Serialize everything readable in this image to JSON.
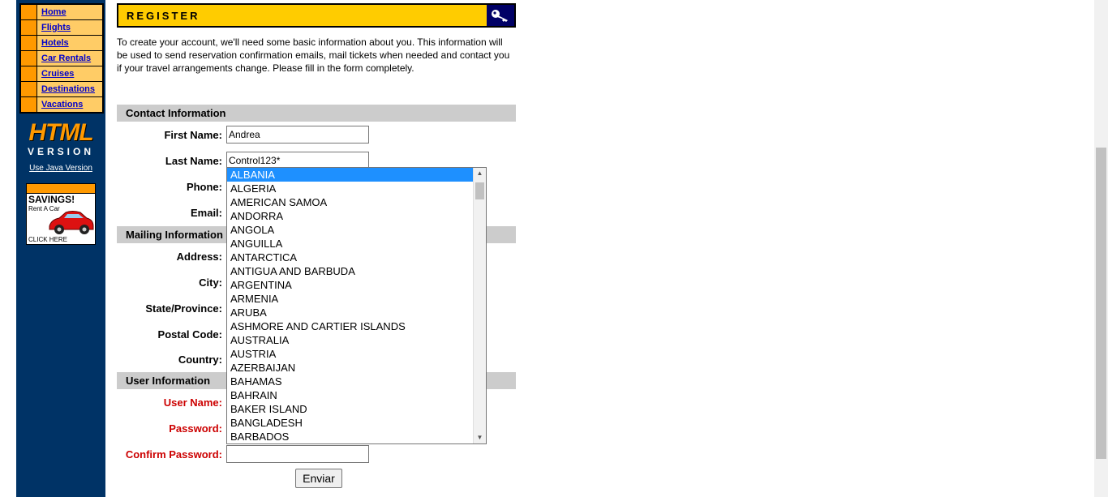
{
  "nav": {
    "items": [
      "Home",
      "Flights",
      "Hotels",
      "Car Rentals",
      "Cruises",
      "Destinations",
      "Vacations"
    ]
  },
  "logo": {
    "line1": "HTML",
    "line2": "VERSION"
  },
  "java_link": "Use Java Version",
  "ad": {
    "title": "SAVINGS!",
    "subtitle": "Rent A Car",
    "cta": "CLICK HERE"
  },
  "header": {
    "title": "REGISTER",
    "icon": "key-icon"
  },
  "intro": "To create your account, we'll need some basic information about you. This information will be used to send reservation confirmation emails, mail tickets when needed and contact you if your travel arrangements change. Please fill in the form completely.",
  "contact": {
    "heading": "Contact Information",
    "first_name_label": "First Name:",
    "first_name_value": "Andrea",
    "last_name_label": "Last Name:",
    "last_name_value": "Control123*",
    "phone_label": "Phone:",
    "email_label": "Email:"
  },
  "mailing": {
    "heading": "Mailing Information",
    "address_label": "Address:",
    "city_label": "City:",
    "state_label": "State/Province:",
    "postal_label": "Postal Code:",
    "country_label": "Country:"
  },
  "user": {
    "heading": "User Information",
    "username_label": "User Name:",
    "password_label": "Password:",
    "confirm_label": "Confirm Password:"
  },
  "submit_label": "Enviar",
  "country_dropdown": {
    "selected": "ALBANIA",
    "options": [
      "ALBANIA",
      "ALGERIA",
      "AMERICAN SAMOA",
      "ANDORRA",
      "ANGOLA",
      "ANGUILLA",
      "ANTARCTICA",
      "ANTIGUA AND BARBUDA",
      "ARGENTINA",
      "ARMENIA",
      "ARUBA",
      "ASHMORE AND CARTIER ISLANDS",
      "AUSTRALIA",
      "AUSTRIA",
      "AZERBAIJAN",
      "BAHAMAS",
      "BAHRAIN",
      "BAKER ISLAND",
      "BANGLADESH",
      "BARBADOS"
    ]
  },
  "colors": {
    "sidebar": "#003366",
    "nav_square": "#ff9900",
    "nav_bg": "#ffcc66",
    "header": "#ffcc00",
    "selection": "#1e90ff",
    "required_label": "#cc0000"
  }
}
